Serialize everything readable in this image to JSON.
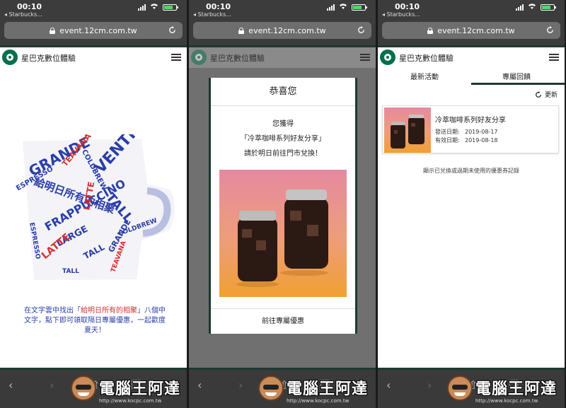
{
  "status": {
    "time": "00:10",
    "back_app": "◂ Starbucks..."
  },
  "browser": {
    "url": "event.12cm.com.tw"
  },
  "site": {
    "title": "星巴克數位體驗"
  },
  "panel1": {
    "caption_pre": "在文字雲中找出「",
    "caption_highlight": "給明日所有的相聚",
    "caption_post": "」八個中文字，點下即可領取隔日專屬優惠，一起歡度夏天！",
    "cloud_words": [
      "GRANDE",
      "VENTI",
      "TALL",
      "LATTE",
      "TEAVANA",
      "COLDBREW",
      "ESPRESSO",
      "FRAPPUCCINO",
      "LARGE",
      "給明日所有的相聚",
      "TALL",
      "GRANDE"
    ]
  },
  "panel2": {
    "title": "恭喜您",
    "line1": "您獲得",
    "line2": "「冷萃咖啡系列好友分享」",
    "line3": "請於明日前往門市兌換！",
    "footer": "前往專屬優惠"
  },
  "panel3": {
    "tab_latest": "最新活動",
    "tab_rewards": "專屬回饋",
    "refresh": "更新",
    "card_title": "冷萃咖啡系列好友分享",
    "issue_label": "發送日期:",
    "issue_date": "2019-08-17",
    "valid_label": "有效日期:",
    "valid_date": "2019-08-18",
    "note": "顯示已兌換或過期未使用的優惠券記錄"
  },
  "watermark": {
    "text": "電腦王阿達",
    "url": "http://www.kocpc.com.tw"
  },
  "colors": {
    "starbucks_green": "#00704a",
    "dark_green": "#1e3932",
    "cloud_blue": "#2a3ea8",
    "cloud_red": "#d6302e"
  }
}
